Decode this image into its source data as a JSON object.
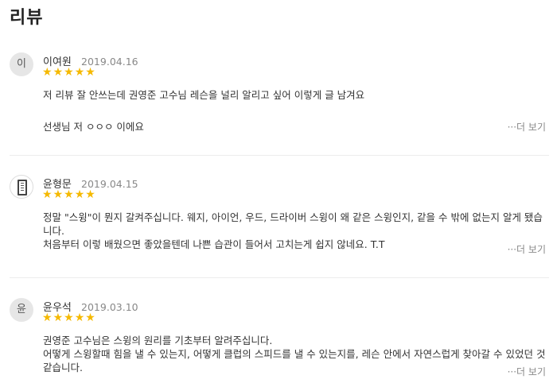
{
  "section_title": "리뷰",
  "more_label": "···더 보기",
  "reviews": [
    {
      "avatar_text": "이",
      "name": "이여원",
      "date": "2019.04.16",
      "rating": 5,
      "lines": [
        "저 리뷰 잘 안쓰는데 권영준 고수님 레슨을 널리 알리고 싶어 이렇게 글 남겨요",
        "",
        "선생님 저 ㅇㅇㅇ 이에요"
      ]
    },
    {
      "avatar_text": "",
      "avatar_icon": "book-icon",
      "name": "윤형문",
      "date": "2019.04.15",
      "rating": 5,
      "lines": [
        "정말 \"스윙\"이 뭔지 갈켜주십니다. 웨지, 아이언, 우드, 드라이버 스윙이 왜 같은 스윙인지, 같을 수 밖에 없는지 알게 됐습니다.",
        "처음부터 이렇 배웠으면 좋았을텐데 나쁜 습관이 들어서 고치는게 쉽지 않네요. T.T"
      ]
    },
    {
      "avatar_text": "윤",
      "name": "윤우석",
      "date": "2019.03.10",
      "rating": 5,
      "lines": [
        "권영준 고수님은 스윙의 원리를 기초부터 알려주십니다.",
        "어떻게 스윙할때 힘을 낼 수 있는지, 어떻게 클럽의 스피드를 낼 수 있는지를, 레슨 안에서 자연스럽게 찾아갈 수 있었던 것 같습니다."
      ]
    }
  ],
  "colors": {
    "star": "#f5b900",
    "text": "#333333",
    "muted": "#888888"
  }
}
